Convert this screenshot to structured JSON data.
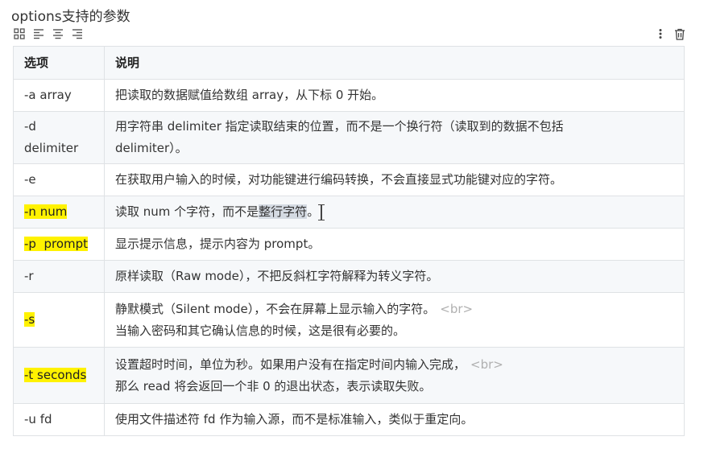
{
  "heading": "options支持的参数",
  "toolbar": {
    "icons": [
      "table-grid-icon",
      "align-left-icon",
      "align-center-icon",
      "align-right-icon",
      "more-vertical-icon",
      "trash-icon"
    ]
  },
  "table": {
    "headers": [
      "选项",
      "说明"
    ],
    "rows": [
      {
        "opt": "-a array",
        "desc": "把读取的数据赋值给数组 array，从下标 0 开始。"
      },
      {
        "opt1": "-d",
        "opt2": "delimiter",
        "desc1": "用字符串 delimiter 指定读取结束的位置，而不是一个换行符（读取到的数据不包括",
        "desc2": "delimiter）。"
      },
      {
        "opt": "-e",
        "desc": "在获取用户输入的时候，对功能键进行编码转换，不会直接显式功能键对应的字符。"
      },
      {
        "opt": "-n num",
        "desc_a": "读取 num 个字符，而不是",
        "desc_sel": "整行字符",
        "desc_b": "。"
      },
      {
        "opt": "-p  prompt",
        "desc": "显示提示信息，提示内容为 prompt。"
      },
      {
        "opt": "-r",
        "desc": "原样读取（Raw mode），不把反斜杠字符解释为转义字符。"
      },
      {
        "opt": "-s",
        "desc1": "静默模式（Silent mode），不会在屏幕上显示输入的字符。",
        "tag": "<br>",
        "desc2": "当输入密码和其它确认信息的时候，这是很有必要的。"
      },
      {
        "opt": "-t seconds",
        "desc1": "设置超时时间，单位为秒。如果用户没有在指定时间内输入完成，",
        "tag": "<br>",
        "desc2": "那么 read 将会返回一个非 0 的退出状态，表示读取失败。"
      },
      {
        "opt": "-u fd",
        "desc": "使用文件描述符 fd 作为输入源，而不是标准输入，类似于重定向。"
      }
    ]
  },
  "colors": {
    "highlight": "#fff200",
    "border": "#dfe2e5",
    "stripe": "#f6f8fa"
  }
}
